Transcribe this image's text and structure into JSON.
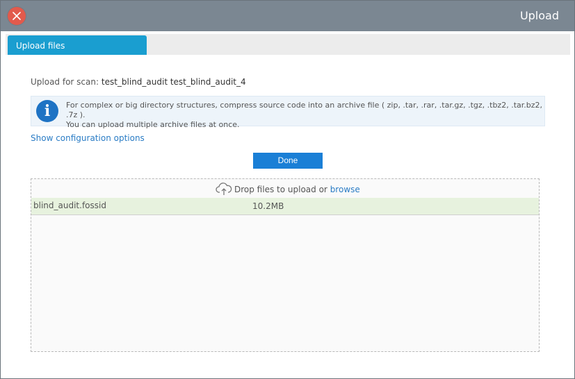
{
  "window": {
    "title": "Upload"
  },
  "tabs": [
    {
      "label": "Upload files"
    }
  ],
  "scan": {
    "label": "Upload for scan:",
    "name": "test_blind_audit test_blind_audit_4"
  },
  "info": {
    "line1": "For complex or big directory structures, compress source code into an archive file ( zip, .tar, .rar, .tar.gz, .tgz, .tbz2, .tar.bz2, .7z ).",
    "line2": "You can upload multiple archive files at once."
  },
  "config_link": "Show configuration options",
  "done_button": "Done",
  "dropzone": {
    "hint": "Drop files to upload or",
    "browse": "browse"
  },
  "files": [
    {
      "name": "blind_audit.fossid",
      "size": "10.2MB"
    }
  ],
  "colors": {
    "titlebar": "#7b8792",
    "accent": "#1a9ed0",
    "button": "#1a7fd6",
    "close": "#e25a4c",
    "file_row": "#e7f2de"
  },
  "icons": {
    "close": "close-icon",
    "info": "info-icon",
    "upload": "cloud-upload-icon"
  }
}
